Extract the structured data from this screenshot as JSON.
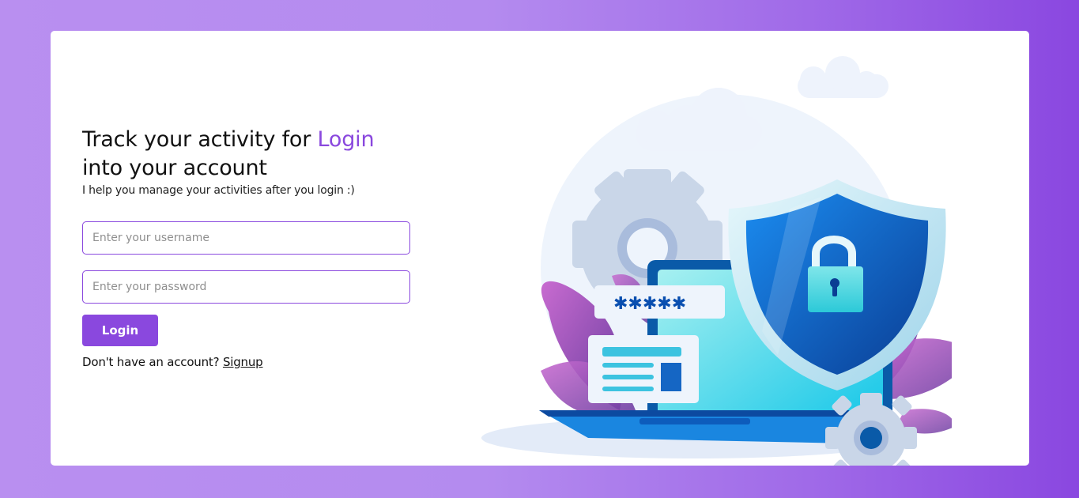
{
  "header": {
    "title_part1": "Track your activity for ",
    "title_accent": "Login",
    "title_part2": "into your account",
    "subtitle": "I help you manage your activities after you login :)"
  },
  "form": {
    "username_placeholder": "Enter your username",
    "username_value": "",
    "password_placeholder": "Enter your password",
    "password_value": "",
    "login_label": "Login"
  },
  "signup": {
    "prompt": "Don't have an account? ",
    "link_label": "Signup"
  },
  "illustration": {
    "password_mask": "✱✱✱✱✱",
    "icons": [
      "cloud-icon",
      "gear-icon",
      "shield-icon",
      "padlock-icon",
      "laptop-icon",
      "leaf-icon"
    ]
  },
  "colors": {
    "accent": "#8a48de",
    "background_start": "#b98ff0",
    "background_end": "#8a47e0",
    "card": "#ffffff"
  }
}
